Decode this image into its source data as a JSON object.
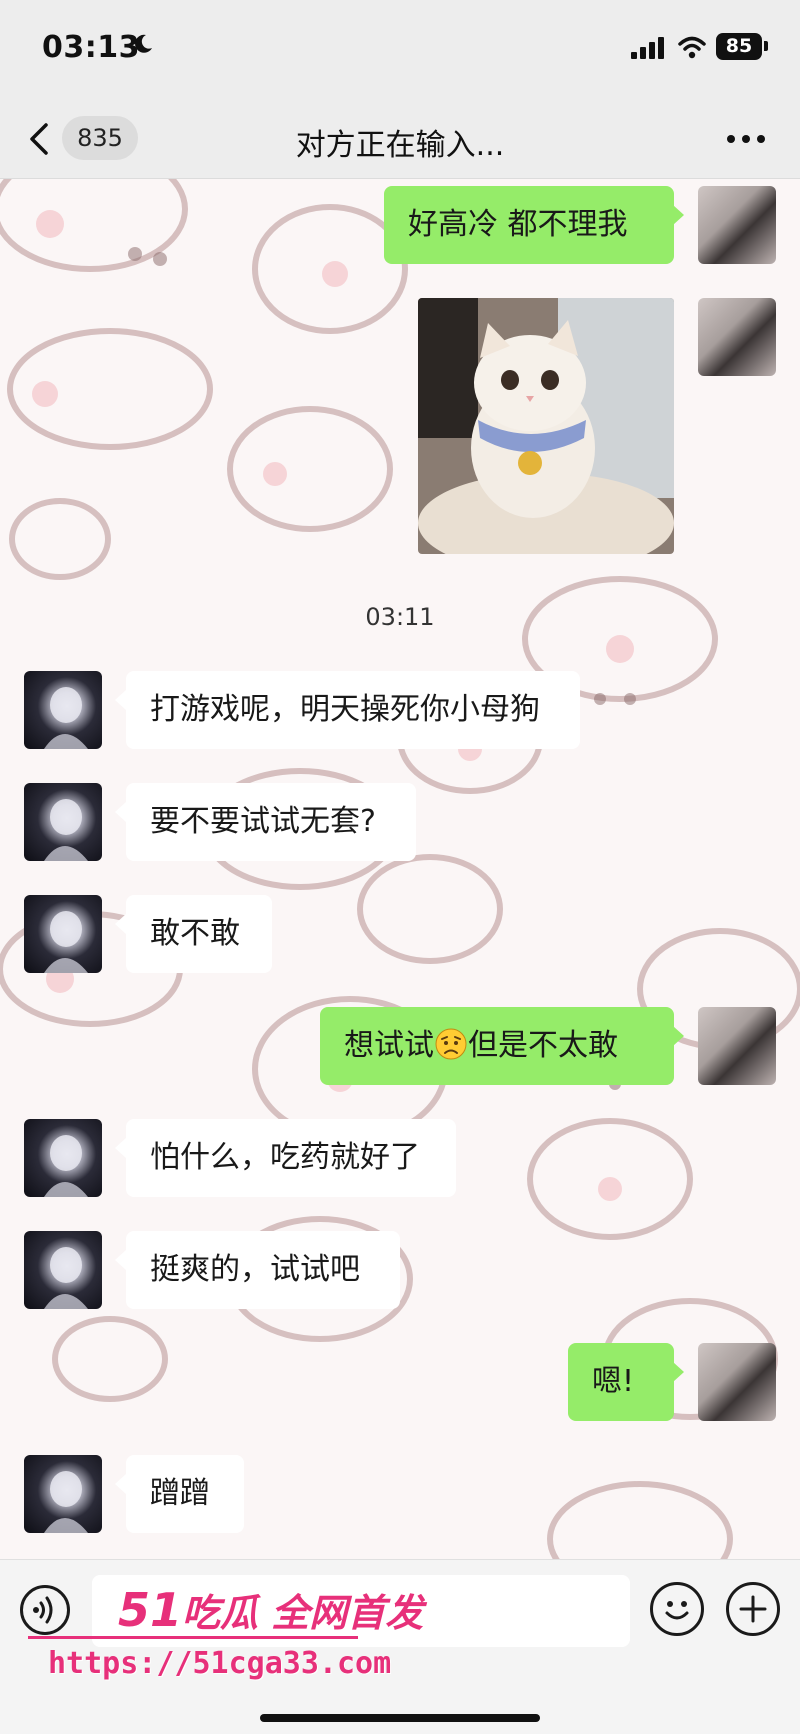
{
  "status_bar": {
    "time": "03:13",
    "battery": "85",
    "icons": [
      "moon-icon",
      "signal-icon",
      "wifi-icon",
      "battery-icon"
    ]
  },
  "nav": {
    "unread_count": "835",
    "title": "对方正在输入...",
    "icons": [
      "chevron-left-icon",
      "more-icon"
    ]
  },
  "messages": [
    {
      "side": "me",
      "type": "text",
      "text": "好高冷 都不理我"
    },
    {
      "side": "me",
      "type": "image",
      "subject": "white kitten with blue collar and bell"
    },
    {
      "type": "timestamp",
      "text": "03:11"
    },
    {
      "side": "other",
      "type": "text",
      "text": "打游戏呢，明天操死你小母狗"
    },
    {
      "side": "other",
      "type": "text",
      "text": "要不要试试无套?"
    },
    {
      "side": "other",
      "type": "text",
      "text": "敢不敢"
    },
    {
      "side": "me",
      "type": "text",
      "text_before": "想试试",
      "emoji": "worried-face-icon",
      "text_after": "但是不太敢"
    },
    {
      "side": "other",
      "type": "text",
      "text": "怕什么，吃药就好了"
    },
    {
      "side": "other",
      "type": "text",
      "text": "挺爽的，试试吧"
    },
    {
      "side": "me",
      "type": "text",
      "text": "嗯!"
    },
    {
      "side": "other",
      "type": "text",
      "text": "蹭蹭"
    }
  ],
  "input_bar": {
    "icons": [
      "voice-icon",
      "emoji-icon",
      "plus-icon"
    ]
  },
  "watermark": {
    "brand_number": "51",
    "brand_text": "吃瓜 全网首发",
    "url": "https://51cga33.com"
  },
  "colors": {
    "bubble_me": "#95ec69",
    "bubble_other": "#ffffff",
    "nav_background": "#ededed",
    "watermark": "#e7307a"
  }
}
